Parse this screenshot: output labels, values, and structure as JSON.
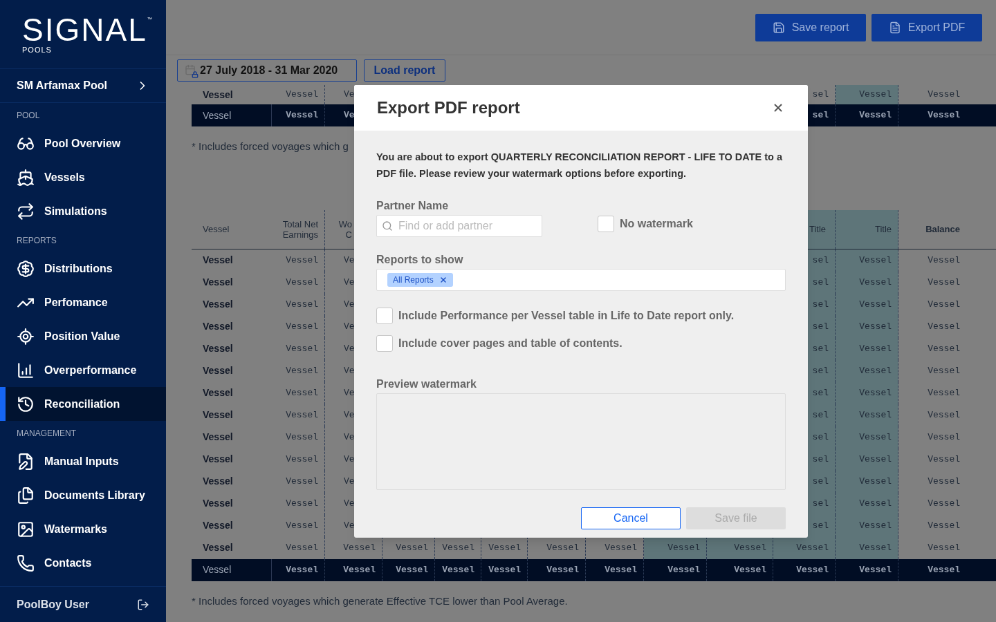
{
  "sidebar": {
    "logo": {
      "wordmark": "SIGNAL",
      "trademark": "™",
      "subtitle": "POOLS"
    },
    "pool_selector": "SM Arfamax Pool",
    "sections": [
      {
        "heading": "POOL",
        "items": [
          {
            "label": "Pool Overview",
            "selected": false
          },
          {
            "label": "Vessels",
            "selected": false
          },
          {
            "label": "Simulations",
            "selected": false
          }
        ]
      },
      {
        "heading": "REPORTS",
        "items": [
          {
            "label": "Distributions",
            "selected": false
          },
          {
            "label": "Perfomance",
            "selected": false
          },
          {
            "label": "Position Value",
            "selected": false
          },
          {
            "label": "Overperformance",
            "selected": false
          },
          {
            "label": "Reconciliation",
            "selected": true
          }
        ]
      },
      {
        "heading": "MANAGEMENT",
        "items": [
          {
            "label": "Manual Inputs",
            "selected": false
          },
          {
            "label": "Documents Library",
            "selected": false
          },
          {
            "label": "Watermarks",
            "selected": false
          },
          {
            "label": "Contacts",
            "selected": false
          }
        ]
      }
    ],
    "user": "PoolBoy User"
  },
  "toolbar": {
    "buttons": [
      {
        "label": "Save report"
      },
      {
        "label": "Export PDF"
      }
    ]
  },
  "filter": {
    "date_range": "27 July 2018 - 31 Mar 2020",
    "load_button": "Load report"
  },
  "tables": [
    {
      "left_columns": [
        {
          "highlighted": false
        },
        {
          "highlighted": false
        },
        {
          "highlighted": false
        }
      ],
      "right_columns": [
        {
          "highlighted": false
        },
        {
          "highlighted": true
        },
        {
          "highlighted": false
        }
      ],
      "rows": [
        {
          "kind": "row",
          "vessel": "Vessel",
          "left": [
            "Vessel",
            "Ve"
          ],
          "right": [
            "sel",
            "Vessel",
            "Vessel"
          ]
        },
        {
          "kind": "total",
          "vessel": "Vessel",
          "left": [
            "Vessel",
            "Ve"
          ],
          "right": [
            "sel",
            "Vessel",
            "Vessel"
          ]
        }
      ],
      "footnote": "* Includes forced voyages which g"
    },
    {
      "left_columns": [
        {
          "label": "Vessel",
          "bold": false,
          "highlighted": false
        },
        {
          "label": "Total Net Earnings",
          "bold": false,
          "highlighted": false
        },
        {
          "label": "Wo\nC",
          "bold": false,
          "highlighted": false
        }
      ],
      "middle_columns": [
        {
          "highlighted": false
        },
        {
          "highlighted": false
        },
        {
          "highlighted": false
        },
        {
          "highlighted": false
        },
        {
          "highlighted": false
        },
        {
          "highlighted": true
        },
        {
          "highlighted": true
        }
      ],
      "right_columns": [
        {
          "label": "Title",
          "bold": false,
          "highlighted": true
        },
        {
          "label": "Title",
          "bold": false,
          "highlighted": true
        },
        {
          "label": "Balance",
          "bold": true,
          "highlighted": false
        }
      ],
      "rows": [
        {
          "kind": "row",
          "vessel": "Vessel",
          "left": [
            "Vessel",
            "Ve"
          ],
          "right": [
            "sel",
            "Vessel",
            "Vessel"
          ]
        },
        {
          "kind": "row",
          "vessel": "Vessel",
          "left": [
            "Vessel",
            "Ve"
          ],
          "right": [
            "sel",
            "Vessel",
            "Vessel"
          ]
        },
        {
          "kind": "row",
          "vessel": "Vessel",
          "left": [
            "Vessel",
            "Ve"
          ],
          "right": [
            "sel",
            "Vessel",
            "Vessel"
          ]
        },
        {
          "kind": "row",
          "vessel": "Vessel",
          "left": [
            "Vessel",
            "Ve"
          ],
          "right": [
            "sel",
            "Vessel",
            "Vessel"
          ]
        },
        {
          "kind": "row",
          "vessel": "Vessel",
          "left": [
            "Vessel",
            "Ve"
          ],
          "right": [
            "sel",
            "Vessel",
            "Vessel"
          ]
        },
        {
          "kind": "row",
          "vessel": "Vessel",
          "left": [
            "Vessel",
            "Ve"
          ],
          "right": [
            "sel",
            "Vessel",
            "Vessel"
          ]
        },
        {
          "kind": "row",
          "vessel": "Vessel",
          "left": [
            "Vessel",
            "Ve"
          ],
          "right": [
            "sel",
            "Vessel",
            "Vessel"
          ]
        },
        {
          "kind": "row",
          "vessel": "Vessel",
          "left": [
            "Vessel",
            "Ve"
          ],
          "right": [
            "sel",
            "Vessel",
            "Vessel"
          ]
        },
        {
          "kind": "row",
          "vessel": "Vessel",
          "left": [
            "Vessel",
            "Ve"
          ],
          "right": [
            "sel",
            "Vessel",
            "Vessel"
          ]
        },
        {
          "kind": "row",
          "vessel": "Vessel",
          "left": [
            "Vessel",
            "Ve"
          ],
          "right": [
            "sel",
            "Vessel",
            "Vessel"
          ]
        },
        {
          "kind": "row",
          "vessel": "Vessel",
          "left": [
            "Vessel",
            "Ve"
          ],
          "right": [
            "sel",
            "Vessel",
            "Vessel"
          ]
        },
        {
          "kind": "row",
          "vessel": "Vessel",
          "left": [
            "Vessel",
            "Ve"
          ],
          "right": [
            "sel",
            "Vessel",
            "Vessel"
          ]
        },
        {
          "kind": "row",
          "vessel": "Vessel",
          "left": [
            "Vessel",
            "Ve"
          ],
          "right": [
            "sel",
            "Vessel",
            "Vessel"
          ]
        },
        {
          "kind": "row",
          "vessel": "Vessel",
          "cells": [
            "Vessel",
            "Vessel",
            "Vessel",
            "Vessel",
            "Vessel",
            "Vessel",
            "Vessel",
            "Vessel",
            "Vessel",
            "Vessel",
            "Vessel",
            "Vessel"
          ]
        },
        {
          "kind": "total",
          "vessel": "Vessel",
          "cells": [
            "Vessel",
            "Vessel",
            "Vessel",
            "Vessel",
            "Vessel",
            "Vessel",
            "Vessel",
            "Vessel",
            "Vessel",
            "Vessel",
            "Vessel",
            "Vessel"
          ]
        }
      ],
      "footnote": "* Includes forced voyages which generate Effective TCE lower than Pool Average."
    }
  ],
  "modal": {
    "title": "Export PDF report",
    "message": "You are about to export QUARTERLY RECONCILIATION REPORT - LIFE TO DATE to a PDF file. Please review your watermark options before exporting.",
    "partner_label": "Partner Name",
    "partner_placeholder": "Find or add partner",
    "no_watermark": {
      "label": "No watermark",
      "checked": false
    },
    "reports_label": "Reports to show",
    "reports_chips": [
      "All Reports"
    ],
    "options": [
      {
        "label": "Include Performance per Vessel table in Life to Date report only.",
        "checked": false
      },
      {
        "label": "Include cover pages and table of contents.",
        "checked": false
      }
    ],
    "preview_label": "Preview watermark",
    "buttons": [
      {
        "label": "Cancel",
        "disabled": false
      },
      {
        "label": "Save file",
        "disabled": true
      }
    ]
  }
}
